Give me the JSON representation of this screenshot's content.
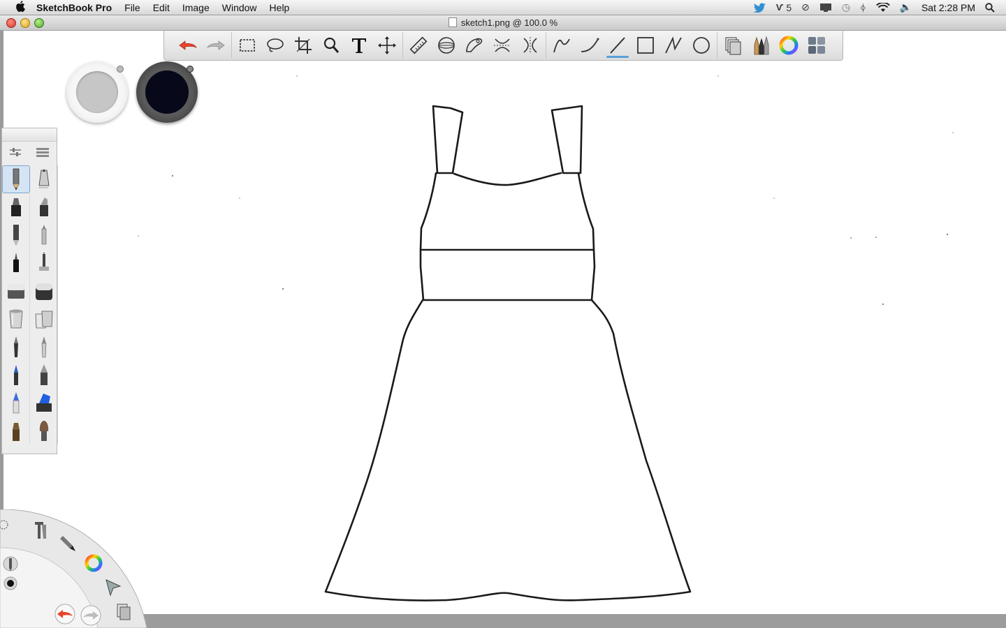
{
  "menubar": {
    "app_name": "SketchBook Pro",
    "menus": [
      "File",
      "Edit",
      "Image",
      "Window",
      "Help"
    ],
    "adobe_count": "5",
    "clock": "Sat 2:28 PM",
    "icons": [
      "apple-icon",
      "twitter-icon",
      "adobe-updates-icon",
      "sync-icon",
      "display-icon",
      "time-machine-icon",
      "bluetooth-icon",
      "wifi-icon",
      "volume-icon",
      "spotlight-icon"
    ]
  },
  "window": {
    "title": "sketch1.png @ 100.0 %"
  },
  "toolbar": {
    "tools": [
      "undo",
      "redo",
      "rectangle-select",
      "lasso-select",
      "crop",
      "zoom",
      "text",
      "move-transform",
      "ruler",
      "ellipse-guide",
      "french-curve",
      "symmetry-x",
      "symmetry-y",
      "line-tool",
      "curve-tool",
      "straight-line",
      "rectangle-tool",
      "polyline-tool",
      "ellipse-tool",
      "layers",
      "brush-palette",
      "color-wheel",
      "copic-library"
    ],
    "active_tool": "straight-line"
  },
  "colors": {
    "secondary": "#c6c6c6",
    "primary": "#07091a",
    "accent": "#5aa0d8"
  },
  "brushes": [
    "pencil",
    "airbrush",
    "marker",
    "chisel-marker",
    "ballpoint-pen",
    "felt-pen",
    "fineliner",
    "ink-pen",
    "hard-eraser",
    "soft-eraser",
    "paint-bucket",
    "fill-bucket",
    "paint-brush",
    "smudge",
    "blur",
    "sharpen",
    "watercolor",
    "highlighter",
    "flat-brush",
    "hair-brush"
  ],
  "lagoon": {
    "items": [
      "settings",
      "tools",
      "brush",
      "color-wheel",
      "select",
      "layers",
      "undo",
      "redo"
    ]
  }
}
